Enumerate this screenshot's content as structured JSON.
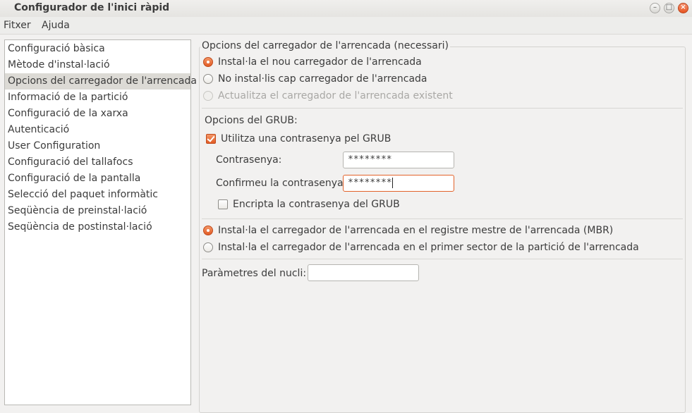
{
  "window": {
    "title": "Configurador de l'inici ràpid",
    "minimize_glyph": "–",
    "maximize_glyph": "□",
    "close_glyph": "×"
  },
  "menu": [
    "Fitxer",
    "Ajuda"
  ],
  "sidebar": {
    "items": [
      "Configuració bàsica",
      "Mètode d'instal·lació",
      "Opcions del carregador de l'arrencada",
      "Informació de la partició",
      "Configuració de la xarxa",
      "Autenticació",
      "User Configuration",
      "Configuració del tallafocs",
      "Configuració de la pantalla",
      "Selecció del paquet informàtic",
      "Seqüència de preinstal·lació",
      "Seqüència de postinstal·lació"
    ],
    "selected_index": 2
  },
  "bootloader": {
    "frame_title": "Opcions del carregador de l'arrencada (necessari)",
    "install_new": "Instal·la el nou carregador de l'arrencada",
    "no_install": "No instal·lis cap carregador de l'arrencada",
    "update_existing": "Actualitza el carregador de l'arrencada existent",
    "grub_options_label": "Opcions del GRUB:",
    "use_password": "Utilitza una contrasenya pel GRUB",
    "password_label": "Contrasenya:",
    "password_value": "********",
    "confirm_label": "Confirmeu la contrasenya:",
    "confirm_value": "********",
    "encrypt_password": "Encripta la contrasenya del GRUB",
    "install_mbr": "Instal·la el carregador de l'arrencada en el registre mestre de l'arrencada (MBR)",
    "install_first_sector": "Instal·la el carregador de l'arrencada en el primer sector de la partició de l'arrencada",
    "kernel_params_label": "Paràmetres del nucli:",
    "kernel_params_value": ""
  },
  "colors": {
    "accent": "#e25c25",
    "selected_row": "#dcdad5",
    "window_bg": "#f2f1f0"
  }
}
